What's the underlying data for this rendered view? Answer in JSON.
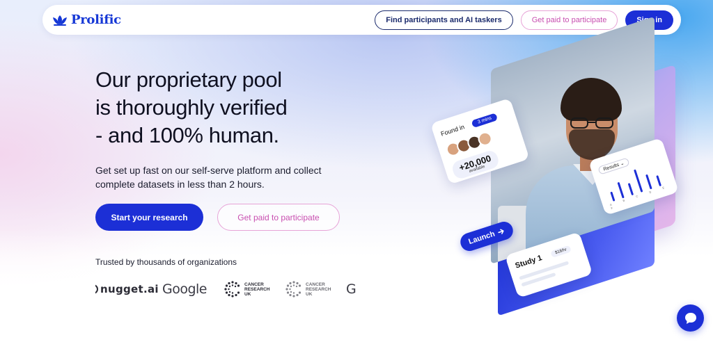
{
  "nav": {
    "brand": "Prolific",
    "find_participants": "Find participants and AI taskers",
    "get_paid": "Get paid to participate",
    "sign_in": "Sign in"
  },
  "hero": {
    "headline": [
      "Our proprietary pool",
      "is thoroughly verified",
      "- and 100% human."
    ],
    "subtext": [
      "Get set up fast on our self-serve platform and collect",
      "complete datasets in less than 2 hours."
    ],
    "cta_primary": "Start your research",
    "cta_secondary": "Get paid to participate"
  },
  "trusted": {
    "label": "Trusted by thousands of organizations",
    "logos": {
      "nugget": "nugget.ai",
      "google": "Google",
      "cruk": [
        "CANCER",
        "RESEARCH",
        "UK"
      ],
      "partial": "G"
    }
  },
  "illustration": {
    "found_label": "Found in",
    "found_time": "3 mins",
    "found_count": "+20,000",
    "found_sub": "available",
    "results_label": "Results",
    "results_axis": "A B C D E F",
    "launch_label": "Launch",
    "study_title": "Study 1",
    "study_rate": "$18/hr"
  },
  "colors": {
    "accent": "#1c2fd6",
    "pink": "#c84eb0",
    "navy": "#1a2a6c"
  },
  "icons": {
    "brand": "prolific-logo-icon",
    "chat": "chat-bubble-icon",
    "launch": "arrow-right-icon"
  }
}
